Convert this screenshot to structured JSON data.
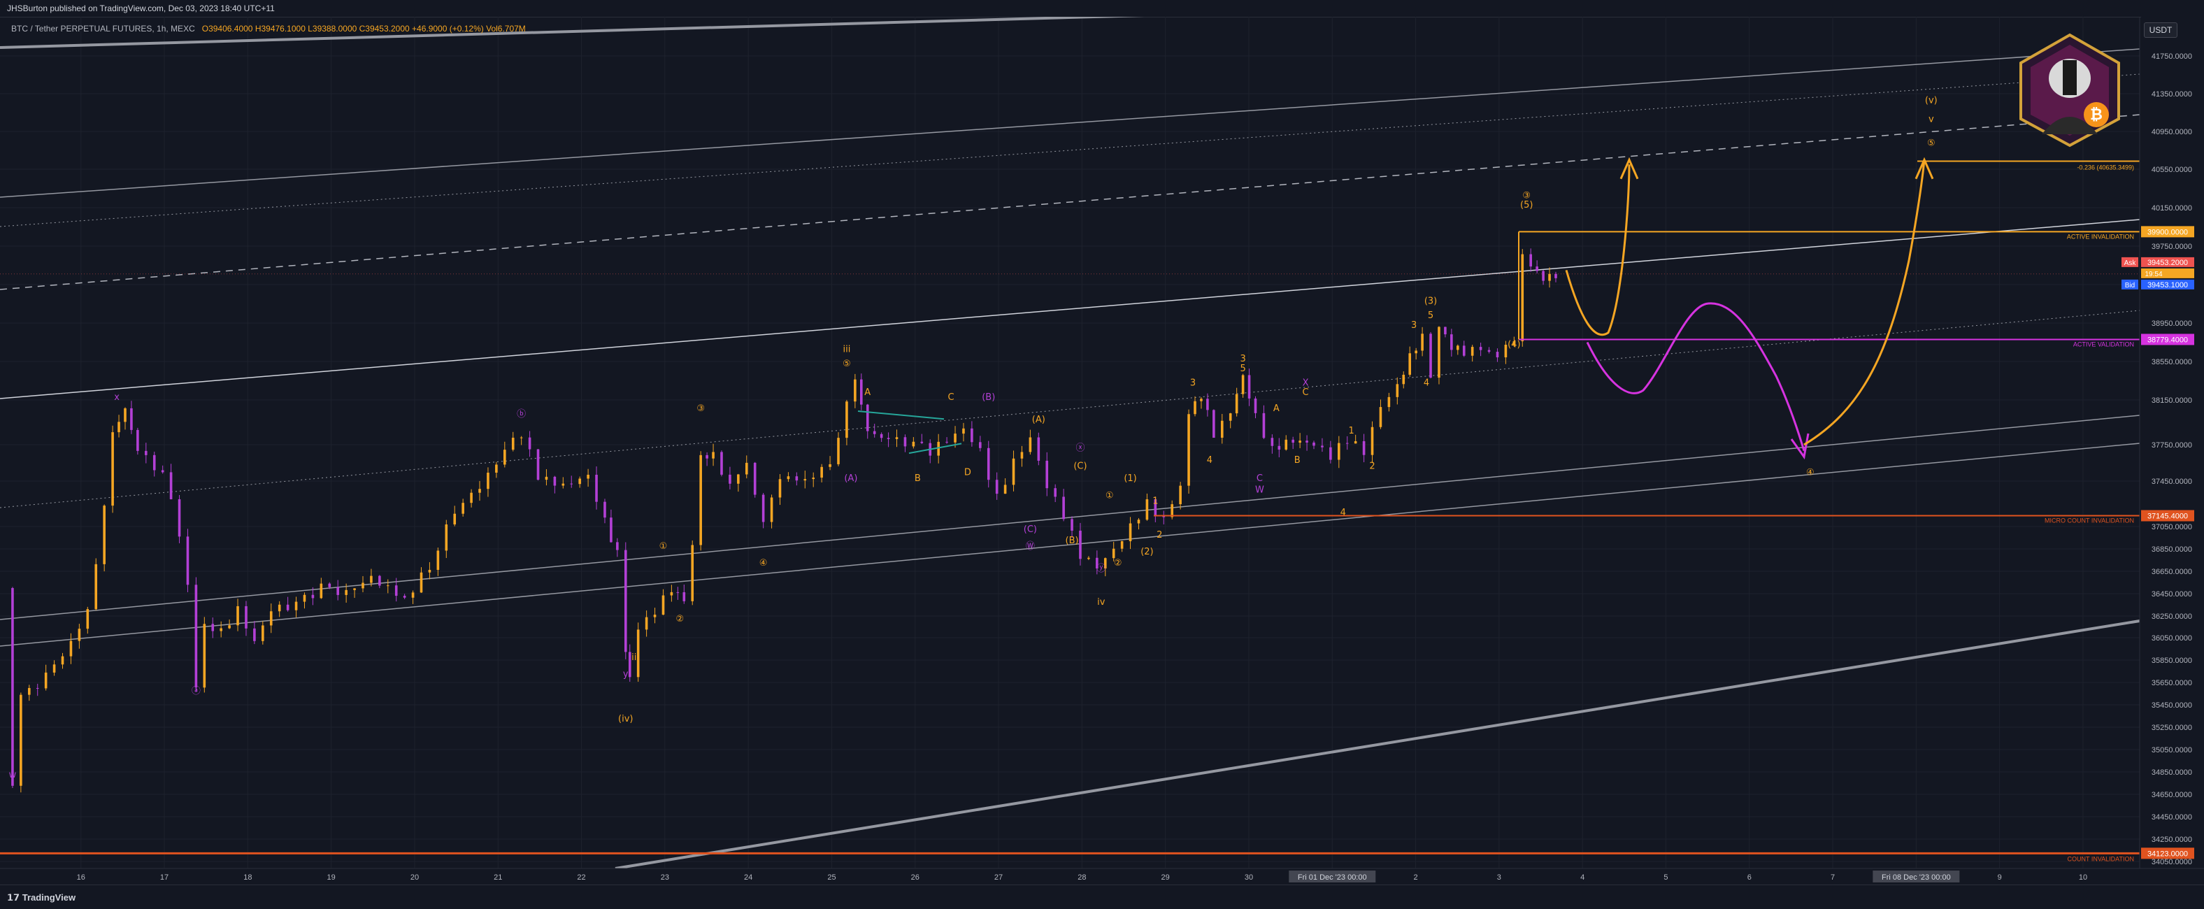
{
  "header": {
    "published_by": "JHSBurton published on TradingView.com, Dec 03, 2023 18:40 UTC+11",
    "symbol_line": "BTC / Tether PERPETUAL FUTURES, 1h, MEXC",
    "ohlc": "O39406.4000  H39476.1000  L39388.0000  C39453.2000  +46.9000 (+0.12%)  Vol6.707M"
  },
  "currency_button": "USDT",
  "footer": {
    "brand": "TradingView"
  },
  "levels": {
    "active_invalidation": {
      "label": "ACTIVE INVALIDATION",
      "price": 39900,
      "tag": "39900.0000",
      "color": "#f5a623"
    },
    "active_validation": {
      "label": "ACTIVE VALIDATION",
      "price": 38779.4,
      "tag": "38779.4000",
      "color": "#d633e0"
    },
    "micro_count_invalidation": {
      "label": "MICRO COUNT INVALIDATION",
      "price": 37145.4,
      "tag": "37145.4000",
      "color": "#e0531f"
    },
    "count_invalidation": {
      "label": "COUNT INVALIDATION",
      "price": 34123,
      "tag": "34123.0000",
      "color": "#e0531f"
    },
    "fib": {
      "label": "-0.236 (40635.3499)",
      "price": 40635.35,
      "color": "#f5a623"
    }
  },
  "quotes": {
    "ask_label": "Ask",
    "ask": "39453.2000",
    "current": "39453.2000",
    "countdown": "19:54",
    "bid_label": "Bid",
    "bid": "39453.1000"
  },
  "chart_data": {
    "type": "candlestick",
    "symbol": "BTC / Tether PERPETUAL FUTURES",
    "timeframe": "1h",
    "exchange": "MEXC",
    "x_ticks": [
      "16",
      "17",
      "18",
      "19",
      "20",
      "21",
      "22",
      "23",
      "24",
      "25",
      "26",
      "27",
      "28",
      "29",
      "30",
      "Fri 01 Dec '23   00:00",
      "2",
      "3",
      "4",
      "5",
      "6",
      "7",
      "Fri 08 Dec '23   00:00",
      "9",
      "10"
    ],
    "y_ticks": [
      41750,
      41350,
      40950,
      40550,
      40150,
      39750,
      39350,
      38950,
      38550,
      38150,
      37750,
      37450,
      37050,
      36850,
      36650,
      36450,
      36250,
      36050,
      35850,
      35650,
      35450,
      35250,
      35050,
      34850,
      34650,
      34450,
      34250,
      34050
    ],
    "ylim": [
      33950,
      42050
    ],
    "price_path": [
      [
        0,
        36500
      ],
      [
        0.1,
        34700
      ],
      [
        0.2,
        35500
      ],
      [
        0.5,
        35700
      ],
      [
        0.8,
        36000
      ],
      [
        1.0,
        36300
      ],
      [
        1.2,
        37200
      ],
      [
        1.3,
        37900
      ],
      [
        1.45,
        38050
      ],
      [
        1.6,
        37700
      ],
      [
        1.9,
        37500
      ],
      [
        2.1,
        37000
      ],
      [
        2.2,
        36500
      ],
      [
        2.3,
        35600
      ],
      [
        2.4,
        36200
      ],
      [
        2.6,
        36100
      ],
      [
        2.8,
        36300
      ],
      [
        3.0,
        36000
      ],
      [
        3.2,
        36300
      ],
      [
        3.5,
        36350
      ],
      [
        3.8,
        36500
      ],
      [
        4.1,
        36450
      ],
      [
        4.4,
        36600
      ],
      [
        4.8,
        36400
      ],
      [
        5.1,
        36700
      ],
      [
        5.4,
        37200
      ],
      [
        5.7,
        37400
      ],
      [
        6.0,
        37700
      ],
      [
        6.2,
        37850
      ],
      [
        6.4,
        37500
      ],
      [
        6.7,
        37400
      ],
      [
        7.0,
        37500
      ],
      [
        7.2,
        37100
      ],
      [
        7.35,
        36800
      ],
      [
        7.45,
        35950
      ],
      [
        7.5,
        35700
      ],
      [
        7.6,
        36100
      ],
      [
        7.8,
        36300
      ],
      [
        8.0,
        36500
      ],
      [
        8.15,
        36400
      ],
      [
        8.25,
        36900
      ],
      [
        8.35,
        37700
      ],
      [
        8.5,
        37650
      ],
      [
        8.7,
        37400
      ],
      [
        8.9,
        37600
      ],
      [
        9.0,
        37300
      ],
      [
        9.1,
        37050
      ],
      [
        9.3,
        37500
      ],
      [
        9.6,
        37450
      ],
      [
        9.9,
        37600
      ],
      [
        10.1,
        38100
      ],
      [
        10.2,
        38400
      ],
      [
        10.35,
        37850
      ],
      [
        10.6,
        37800
      ],
      [
        10.9,
        37750
      ],
      [
        11.1,
        37700
      ],
      [
        11.3,
        37800
      ],
      [
        11.5,
        37900
      ],
      [
        11.7,
        37700
      ],
      [
        11.9,
        37300
      ],
      [
        12.1,
        37600
      ],
      [
        12.3,
        37800
      ],
      [
        12.5,
        37400
      ],
      [
        12.7,
        37150
      ],
      [
        12.9,
        36800
      ],
      [
        13.1,
        36700
      ],
      [
        13.3,
        36850
      ],
      [
        13.5,
        37050
      ],
      [
        13.7,
        37250
      ],
      [
        13.9,
        37100
      ],
      [
        14.1,
        37400
      ],
      [
        14.2,
        38000
      ],
      [
        14.35,
        38200
      ],
      [
        14.5,
        37850
      ],
      [
        14.7,
        38050
      ],
      [
        14.85,
        38400
      ],
      [
        15.0,
        38000
      ],
      [
        15.2,
        37700
      ],
      [
        15.45,
        37800
      ],
      [
        15.7,
        37750
      ],
      [
        15.9,
        37650
      ],
      [
        16.1,
        37800
      ],
      [
        16.3,
        37700
      ],
      [
        16.5,
        38100
      ],
      [
        16.7,
        38300
      ],
      [
        16.85,
        38600
      ],
      [
        17.0,
        38800
      ],
      [
        17.1,
        38400
      ],
      [
        17.2,
        38900
      ],
      [
        17.35,
        38700
      ],
      [
        17.5,
        38650
      ],
      [
        17.7,
        38700
      ],
      [
        17.9,
        38600
      ],
      [
        18.0,
        38750
      ],
      [
        18.1,
        38800
      ],
      [
        18.2,
        39700
      ],
      [
        18.3,
        39550
      ],
      [
        18.45,
        39400
      ],
      [
        18.6,
        39450
      ]
    ],
    "wave_labels": [
      {
        "t": "w",
        "x": 0.1,
        "p": 34800,
        "c": "#b340d6"
      },
      {
        "t": "x",
        "x": 1.35,
        "p": 38150,
        "c": "#b340d6"
      },
      {
        "t": "ⓐ",
        "x": 2.3,
        "p": 35550,
        "c": "#b340d6"
      },
      {
        "t": "ⓑ",
        "x": 6.2,
        "p": 38000,
        "c": "#b340d6"
      },
      {
        "t": "y",
        "x": 7.45,
        "p": 35700,
        "c": "#b340d6"
      },
      {
        "t": "ii",
        "x": 7.55,
        "p": 35850,
        "c": "#f5a623"
      },
      {
        "t": "(iv)",
        "x": 7.45,
        "p": 35300,
        "c": "#f5a623"
      },
      {
        "t": "①",
        "x": 7.9,
        "p": 36850,
        "c": "#f5a623"
      },
      {
        "t": "②",
        "x": 8.1,
        "p": 36200,
        "c": "#f5a623"
      },
      {
        "t": "③",
        "x": 8.35,
        "p": 38050,
        "c": "#f5a623"
      },
      {
        "t": "④",
        "x": 9.1,
        "p": 36700,
        "c": "#f5a623"
      },
      {
        "t": "iii",
        "x": 10.1,
        "p": 38650,
        "c": "#f5a623"
      },
      {
        "t": "⑤",
        "x": 10.1,
        "p": 38500,
        "c": "#f5a623"
      },
      {
        "t": "A",
        "x": 10.35,
        "p": 38200,
        "c": "#f5a623"
      },
      {
        "t": "B",
        "x": 10.95,
        "p": 37450,
        "c": "#f5a623"
      },
      {
        "t": "C",
        "x": 11.35,
        "p": 38150,
        "c": "#f5a623"
      },
      {
        "t": "D",
        "x": 11.55,
        "p": 37500,
        "c": "#f5a623"
      },
      {
        "t": "(B)",
        "x": 11.8,
        "p": 38150,
        "c": "#b340d6"
      },
      {
        "t": "(A)",
        "x": 10.15,
        "p": 37450,
        "c": "#b340d6"
      },
      {
        "t": "(A)",
        "x": 12.4,
        "p": 37950,
        "c": "#f5a623"
      },
      {
        "t": "(C)",
        "x": 12.3,
        "p": 37000,
        "c": "#b340d6"
      },
      {
        "t": "Ⓦ",
        "x": 12.3,
        "p": 36850,
        "c": "#b340d6"
      },
      {
        "t": "(B)",
        "x": 12.8,
        "p": 36900,
        "c": "#f5a623"
      },
      {
        "t": "ⓧ",
        "x": 12.9,
        "p": 37700,
        "c": "#b340d6"
      },
      {
        "t": "(C)",
        "x": 12.9,
        "p": 37550,
        "c": "#f5a623"
      },
      {
        "t": "ⓨ",
        "x": 13.15,
        "p": 36650,
        "c": "#b340d6"
      },
      {
        "t": "iv",
        "x": 13.15,
        "p": 36350,
        "c": "#f5a623"
      },
      {
        "t": "①",
        "x": 13.25,
        "p": 37300,
        "c": "#f5a623"
      },
      {
        "t": "(1)",
        "x": 13.5,
        "p": 37450,
        "c": "#f5a623"
      },
      {
        "t": "②",
        "x": 13.35,
        "p": 36700,
        "c": "#f5a623"
      },
      {
        "t": "(2)",
        "x": 13.7,
        "p": 36800,
        "c": "#f5a623"
      },
      {
        "t": "1",
        "x": 13.8,
        "p": 37250,
        "c": "#f5a623"
      },
      {
        "t": "2",
        "x": 13.85,
        "p": 36950,
        "c": "#f5a623"
      },
      {
        "t": "3",
        "x": 14.25,
        "p": 38300,
        "c": "#f5a623"
      },
      {
        "t": "4",
        "x": 14.45,
        "p": 37600,
        "c": "#f5a623"
      },
      {
        "t": "3",
        "x": 14.85,
        "p": 38550,
        "c": "#f5a623"
      },
      {
        "t": "5",
        "x": 14.85,
        "p": 38450,
        "c": "#f5a623"
      },
      {
        "t": "A",
        "x": 15.25,
        "p": 38050,
        "c": "#f5a623"
      },
      {
        "t": "B",
        "x": 15.5,
        "p": 37600,
        "c": "#f5a623"
      },
      {
        "t": "X",
        "x": 15.6,
        "p": 38300,
        "c": "#b340d6"
      },
      {
        "t": "C",
        "x": 15.6,
        "p": 38200,
        "c": "#f5a623"
      },
      {
        "t": "W",
        "x": 15.05,
        "p": 37350,
        "c": "#b340d6"
      },
      {
        "t": "C",
        "x": 15.05,
        "p": 37450,
        "c": "#b340d6"
      },
      {
        "t": "1",
        "x": 16.15,
        "p": 37850,
        "c": "#f5a623"
      },
      {
        "t": "2",
        "x": 16.4,
        "p": 37550,
        "c": "#f5a623"
      },
      {
        "t": "4",
        "x": 16.05,
        "p": 37150,
        "c": "#f5a623"
      },
      {
        "t": "3",
        "x": 16.9,
        "p": 38900,
        "c": "#f5a623"
      },
      {
        "t": "(3)",
        "x": 17.1,
        "p": 39150,
        "c": "#f5a623"
      },
      {
        "t": "5",
        "x": 17.1,
        "p": 39000,
        "c": "#f5a623"
      },
      {
        "t": "4",
        "x": 17.05,
        "p": 38300,
        "c": "#f5a623"
      },
      {
        "t": "(4)",
        "x": 18.1,
        "p": 38700,
        "c": "#f5a623"
      },
      {
        "t": "③",
        "x": 18.25,
        "p": 40250,
        "c": "#f5a623"
      },
      {
        "t": "(5)",
        "x": 18.25,
        "p": 40150,
        "c": "#f5a623"
      },
      {
        "t": "④",
        "x": 21.65,
        "p": 37500,
        "c": "#f5a623"
      },
      {
        "t": "(v)",
        "x": 23.1,
        "p": 41250,
        "c": "#f5a623"
      },
      {
        "t": "v",
        "x": 23.1,
        "p": 41050,
        "c": "#f5a623"
      },
      {
        "t": "⑤",
        "x": 23.1,
        "p": 40800,
        "c": "#f5a623"
      }
    ]
  },
  "colors": {
    "up": "#f5a623",
    "down": "#b340d6",
    "bg": "#131722",
    "grid": "#1e222d"
  }
}
